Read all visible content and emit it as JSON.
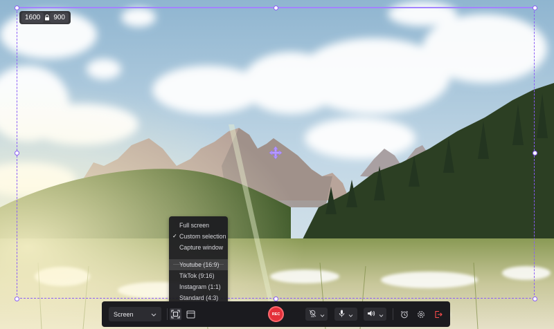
{
  "selection": {
    "width": "1600",
    "height": "900",
    "lock_icon": "lock-icon",
    "move_icon": "move-cross-icon",
    "accent_color": "#8a5cf6"
  },
  "menu": {
    "items": [
      {
        "label": "Full screen"
      },
      {
        "label": "Custom selection",
        "checked": true
      },
      {
        "label": "Capture window"
      },
      {
        "label": "Youtube (16:9)",
        "highlighted": true
      },
      {
        "label": "TikTok (9:16)"
      },
      {
        "label": "Instagram (1:1)"
      },
      {
        "label": "Standard (4:3)"
      }
    ]
  },
  "toolbar": {
    "source_value": "Screen",
    "rec_label": "REC",
    "rec_color": "#e4303a",
    "icons": [
      "chevron-down-icon",
      "custom-area-icon",
      "window-icon",
      "webcam-off-icon",
      "microphone-icon",
      "speaker-icon",
      "alarm-clock-icon",
      "settings-icon",
      "exit-icon"
    ],
    "exit_color": "#ff4d4d"
  }
}
